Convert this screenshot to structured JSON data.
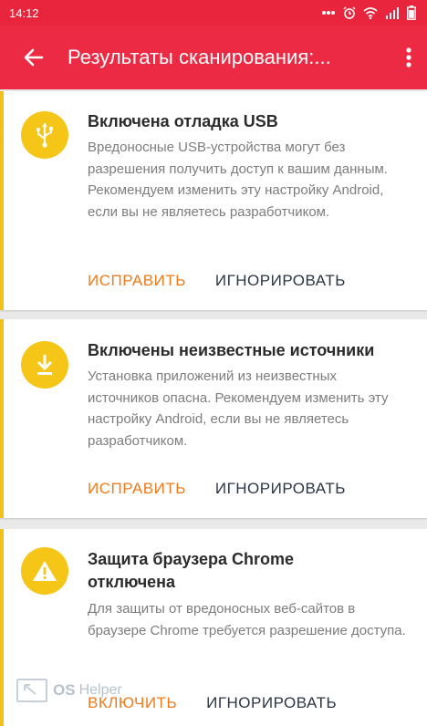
{
  "status_bar": {
    "time": "14:12",
    "icons": [
      "dots-icon",
      "alarm-icon",
      "wifi-icon",
      "signal-icon",
      "battery-icon"
    ]
  },
  "app_bar": {
    "title": "Результаты сканирования:...",
    "back_icon": "arrow-left-icon",
    "menu_icon": "more-vert-icon"
  },
  "cards": [
    {
      "icon": "usb-icon",
      "title": "Включена отладка USB",
      "description": "Вредоносные USB-устройства могут без разрешения получить доступ к вашим данным. Рекомендуем изменить эту настройку Android, если вы не являетесь разработчиком.",
      "primary_action": "ИСПРАВИТЬ",
      "secondary_action": "ИГНОРИРОВАТЬ"
    },
    {
      "icon": "download-icon",
      "title": "Включены неизвестные источники",
      "description": "Установка приложений из неизвестных источников опасна. Рекомендуем изменить эту настройку Android, если вы не являетесь разработчиком.",
      "primary_action": "ИСПРАВИТЬ",
      "secondary_action": "ИГНОРИРОВАТЬ"
    },
    {
      "icon": "warning-icon",
      "title": "Защита браузера Chrome отключена",
      "description": "Для защиты от вредоносных веб-сайтов в браузере Chrome требуется разрешение доступа.",
      "primary_action": "ВКЛЮЧИТЬ",
      "secondary_action": "ИГНОРИРОВАТЬ"
    }
  ],
  "watermark": {
    "brand": "OS",
    "text": "Helper"
  },
  "colors": {
    "app_bar": "#ec2a43",
    "accent_yellow": "#f5c518",
    "primary_action": "#f07a1c",
    "secondary_action": "#2c3545"
  }
}
